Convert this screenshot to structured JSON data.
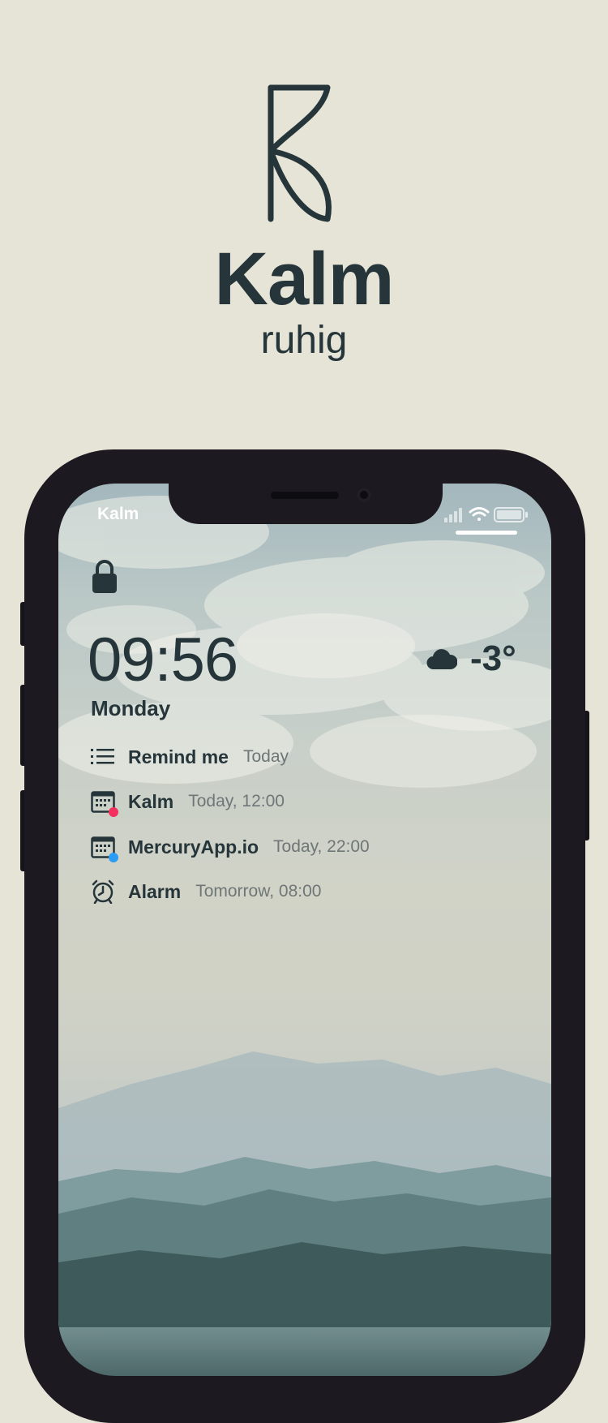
{
  "brand": {
    "title": "Kalm",
    "subtitle": "ruhig"
  },
  "status_bar": {
    "app_name": "Kalm"
  },
  "lock_screen": {
    "time": "09:56",
    "day": "Monday",
    "weather": {
      "icon": "cloud-icon",
      "temperature": "-3°"
    },
    "events": [
      {
        "icon": "list-icon",
        "title": "Remind me",
        "when": "Today"
      },
      {
        "icon": "calendar-icon",
        "title": "Kalm",
        "when": "Today, 12:00",
        "dot_color": "#f2315e"
      },
      {
        "icon": "calendar-icon",
        "title": "MercuryApp.io",
        "when": "Today, 22:00",
        "dot_color": "#2a9cf3"
      },
      {
        "icon": "alarm-clock-icon",
        "title": "Alarm",
        "when": "Tomorrow, 08:00"
      }
    ]
  },
  "colors": {
    "background": "#e5e4d6",
    "text": "#25353a",
    "phone_frame": "#1c1a20"
  }
}
